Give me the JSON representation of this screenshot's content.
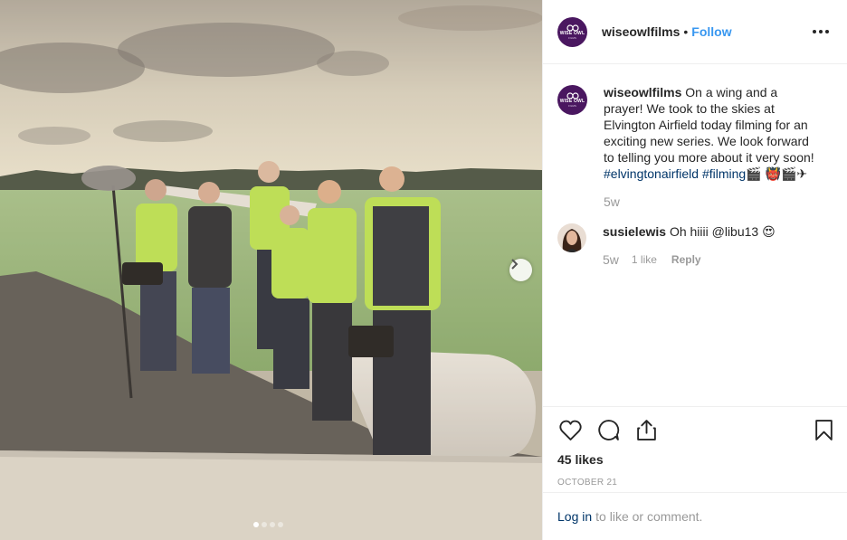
{
  "post": {
    "username": "wiseowlfilms",
    "follow_separator": "•",
    "follow_label": "Follow",
    "avatar_text_main": "WISE OWL",
    "avatar_text_sub": "FILMS"
  },
  "caption": {
    "username": "wiseowlfilms",
    "text": "On a wing and a prayer! We took to the skies at Elvington Airfield today filming for an exciting new series. We look forward to telling you more about it very soon!",
    "hashtag1": "#elvingtonairfield",
    "hashtag2": "#filming",
    "emoji": "🎬 👹🎬✈",
    "time": "5w"
  },
  "reply": {
    "username": "susielewis",
    "text": "Oh hiiii @libu13 😍",
    "time": "5w",
    "likes": "1 like",
    "reply_label": "Reply"
  },
  "actions": {
    "likes": "45 likes",
    "date": "OCTOBER 21"
  },
  "login": {
    "link": "Log in",
    "text": "to like or comment."
  },
  "carousel": {
    "total": 4,
    "active_index": 0
  },
  "icons": {
    "like": "heart-icon",
    "comment": "comment-icon",
    "share": "share-icon",
    "save": "bookmark-icon",
    "next": "chevron-right-icon",
    "more": "more-icon"
  }
}
